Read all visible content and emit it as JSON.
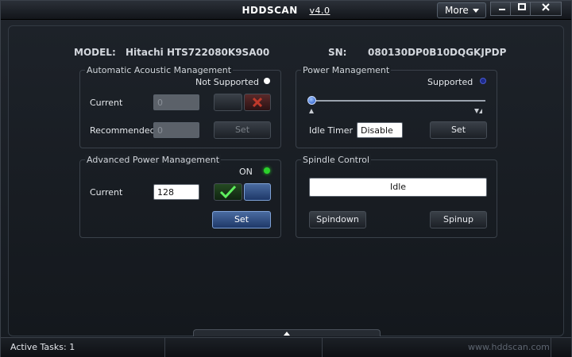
{
  "titlebar": {
    "app_name": "HDDSCAN",
    "version": "v4.0",
    "more_label": "More"
  },
  "device": {
    "model_label": "MODEL:",
    "model_value": "Hitachi HTS722080K9SA00",
    "sn_label": "SN:",
    "sn_value": "080130DP0B10DQGKJPDP"
  },
  "aam": {
    "title": "Automatic Acoustic Management",
    "status": "Not Supported",
    "status_color": "#ffffff",
    "current_label": "Current",
    "current_value": "0",
    "recommended_label": "Recommended",
    "recommended_value": "0",
    "set_label": "Set"
  },
  "apm": {
    "title": "Advanced Power Management",
    "status": "ON",
    "status_color": "#2bd12b",
    "current_label": "Current",
    "current_value": "128",
    "set_label": "Set"
  },
  "power": {
    "title": "Power Management",
    "status": "Supported",
    "status_color": "#1d2a8c",
    "slider_level": 0,
    "idle_timer_label": "Idle Timer",
    "idle_timer_value": "Disable",
    "set_label": "Set"
  },
  "spindle": {
    "title": "Spindle Control",
    "state": "Idle",
    "spindown_label": "Spindown",
    "spinup_label": "Spinup"
  },
  "status": {
    "active_tasks": "Active Tasks: 1",
    "website": "www.hddscan.com"
  },
  "colors": {
    "accent": "#4a6ba0",
    "ok": "#2bd12b",
    "cancel": "#c0392b"
  }
}
